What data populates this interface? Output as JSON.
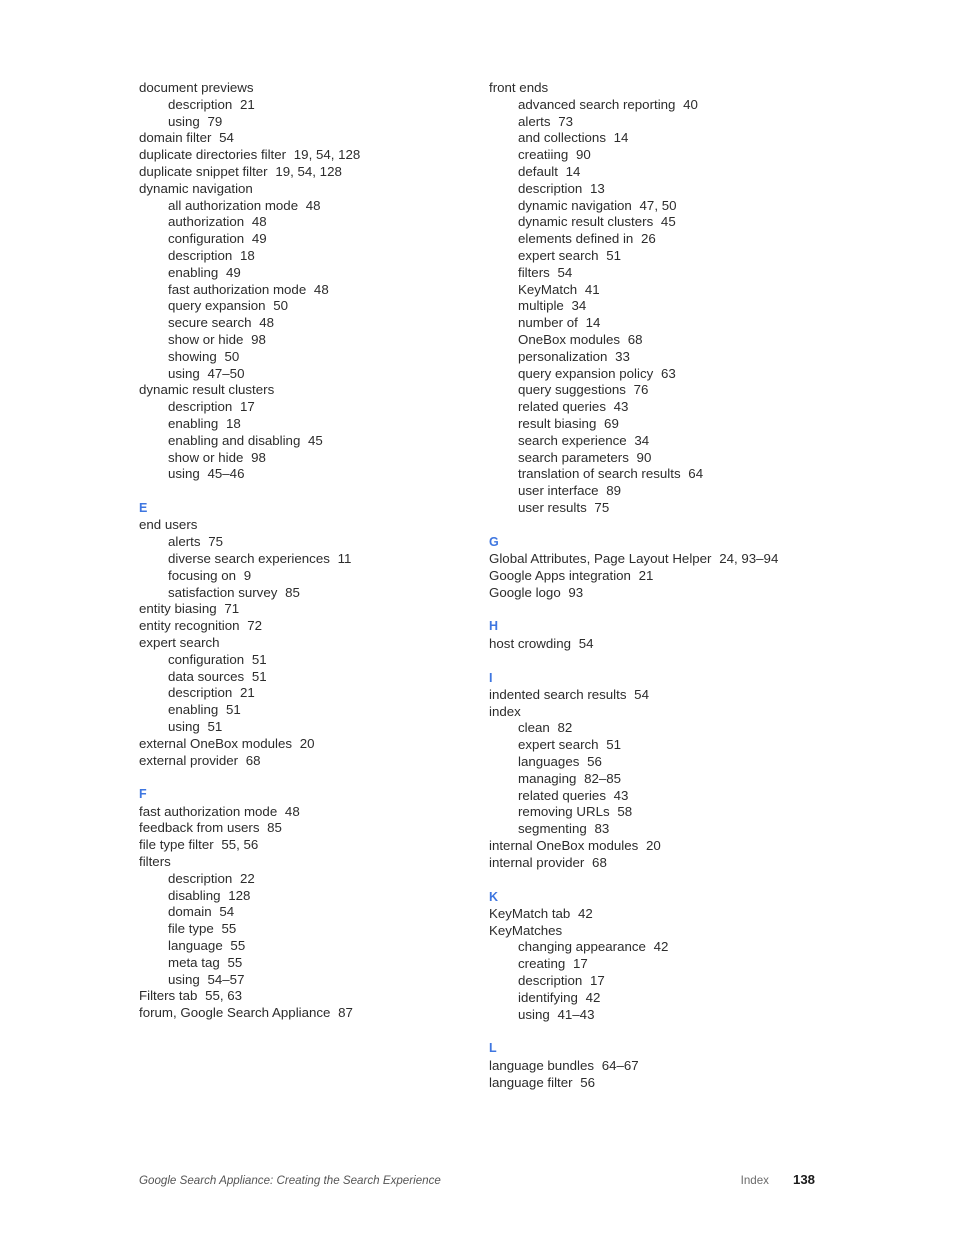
{
  "document": {
    "page_kind": "index",
    "accent_color": "#3e76e0",
    "text_color": "#2c2c2c"
  },
  "columns": [
    {
      "id": "left",
      "sections": [
        {
          "letter": "",
          "entries": [
            {
              "level": 0,
              "text": "document previews",
              "pages": ""
            },
            {
              "level": 1,
              "text": "description",
              "pages": "21"
            },
            {
              "level": 1,
              "text": "using",
              "pages": "79"
            },
            {
              "level": 0,
              "text": "domain filter",
              "pages": "54"
            },
            {
              "level": 0,
              "text": "duplicate directories filter",
              "pages": "19, 54, 128"
            },
            {
              "level": 0,
              "text": "duplicate snippet filter",
              "pages": "19, 54, 128"
            },
            {
              "level": 0,
              "text": "dynamic navigation",
              "pages": ""
            },
            {
              "level": 1,
              "text": "all authorization mode",
              "pages": "48"
            },
            {
              "level": 1,
              "text": "authorization",
              "pages": "48"
            },
            {
              "level": 1,
              "text": "configuration",
              "pages": "49"
            },
            {
              "level": 1,
              "text": "description",
              "pages": "18"
            },
            {
              "level": 1,
              "text": "enabling",
              "pages": "49"
            },
            {
              "level": 1,
              "text": "fast authorization mode",
              "pages": "48"
            },
            {
              "level": 1,
              "text": "query expansion",
              "pages": "50"
            },
            {
              "level": 1,
              "text": "secure search",
              "pages": "48"
            },
            {
              "level": 1,
              "text": "show or hide",
              "pages": "98"
            },
            {
              "level": 1,
              "text": "showing",
              "pages": "50"
            },
            {
              "level": 1,
              "text": "using",
              "pages": "47–50"
            },
            {
              "level": 0,
              "text": "dynamic result clusters",
              "pages": ""
            },
            {
              "level": 1,
              "text": "description",
              "pages": "17"
            },
            {
              "level": 1,
              "text": "enabling",
              "pages": "18"
            },
            {
              "level": 1,
              "text": "enabling and disabling",
              "pages": "45"
            },
            {
              "level": 1,
              "text": "show or hide",
              "pages": "98"
            },
            {
              "level": 1,
              "text": "using",
              "pages": "45–46"
            }
          ]
        },
        {
          "letter": "E",
          "entries": [
            {
              "level": 0,
              "text": "end users",
              "pages": ""
            },
            {
              "level": 1,
              "text": "alerts",
              "pages": "75"
            },
            {
              "level": 1,
              "text": "diverse search experiences",
              "pages": "11"
            },
            {
              "level": 1,
              "text": "focusing on",
              "pages": "9"
            },
            {
              "level": 1,
              "text": "satisfaction survey",
              "pages": "85"
            },
            {
              "level": 0,
              "text": "entity biasing",
              "pages": "71"
            },
            {
              "level": 0,
              "text": "entity recognition",
              "pages": "72"
            },
            {
              "level": 0,
              "text": "expert search",
              "pages": ""
            },
            {
              "level": 1,
              "text": "configuration",
              "pages": "51"
            },
            {
              "level": 1,
              "text": "data sources",
              "pages": "51"
            },
            {
              "level": 1,
              "text": "description",
              "pages": "21"
            },
            {
              "level": 1,
              "text": "enabling",
              "pages": "51"
            },
            {
              "level": 1,
              "text": "using",
              "pages": "51"
            },
            {
              "level": 0,
              "text": "external OneBox modules",
              "pages": "20"
            },
            {
              "level": 0,
              "text": "external provider",
              "pages": "68"
            }
          ]
        },
        {
          "letter": "F",
          "entries": [
            {
              "level": 0,
              "text": "fast authorization mode",
              "pages": "48"
            },
            {
              "level": 0,
              "text": "feedback from users",
              "pages": "85"
            },
            {
              "level": 0,
              "text": "file type filter",
              "pages": "55, 56"
            },
            {
              "level": 0,
              "text": "filters",
              "pages": ""
            },
            {
              "level": 1,
              "text": "description",
              "pages": "22"
            },
            {
              "level": 1,
              "text": "disabling",
              "pages": "128"
            },
            {
              "level": 1,
              "text": "domain",
              "pages": "54"
            },
            {
              "level": 1,
              "text": "file type",
              "pages": "55"
            },
            {
              "level": 1,
              "text": "language",
              "pages": "55"
            },
            {
              "level": 1,
              "text": "meta tag",
              "pages": "55"
            },
            {
              "level": 1,
              "text": "using",
              "pages": "54–57"
            },
            {
              "level": 0,
              "text": "Filters tab",
              "pages": "55, 63"
            },
            {
              "level": 0,
              "text": "forum, Google Search Appliance",
              "pages": "87"
            }
          ]
        }
      ]
    },
    {
      "id": "right",
      "sections": [
        {
          "letter": "",
          "entries": [
            {
              "level": 0,
              "text": "front ends",
              "pages": ""
            },
            {
              "level": 1,
              "text": "advanced search reporting",
              "pages": "40"
            },
            {
              "level": 1,
              "text": "alerts",
              "pages": "73"
            },
            {
              "level": 1,
              "text": "and collections",
              "pages": "14"
            },
            {
              "level": 1,
              "text": "creatiing",
              "pages": "90"
            },
            {
              "level": 1,
              "text": "default",
              "pages": "14"
            },
            {
              "level": 1,
              "text": "description",
              "pages": "13"
            },
            {
              "level": 1,
              "text": "dynamic navigation",
              "pages": "47, 50"
            },
            {
              "level": 1,
              "text": "dynamic result clusters",
              "pages": "45"
            },
            {
              "level": 1,
              "text": "elements defined in",
              "pages": "26"
            },
            {
              "level": 1,
              "text": "expert search",
              "pages": "51"
            },
            {
              "level": 1,
              "text": "filters",
              "pages": "54"
            },
            {
              "level": 1,
              "text": "KeyMatch",
              "pages": "41"
            },
            {
              "level": 1,
              "text": "multiple",
              "pages": "34"
            },
            {
              "level": 1,
              "text": "number of",
              "pages": "14"
            },
            {
              "level": 1,
              "text": "OneBox modules",
              "pages": "68"
            },
            {
              "level": 1,
              "text": "personalization",
              "pages": "33"
            },
            {
              "level": 1,
              "text": "query expansion policy",
              "pages": "63"
            },
            {
              "level": 1,
              "text": "query suggestions",
              "pages": "76"
            },
            {
              "level": 1,
              "text": "related queries",
              "pages": "43"
            },
            {
              "level": 1,
              "text": "result biasing",
              "pages": "69"
            },
            {
              "level": 1,
              "text": "search experience",
              "pages": "34"
            },
            {
              "level": 1,
              "text": "search parameters",
              "pages": "90"
            },
            {
              "level": 1,
              "text": "translation of search results",
              "pages": "64"
            },
            {
              "level": 1,
              "text": "user interface",
              "pages": "89"
            },
            {
              "level": 1,
              "text": "user results",
              "pages": "75"
            }
          ]
        },
        {
          "letter": "G",
          "entries": [
            {
              "level": 0,
              "text": "Global Attributes, Page Layout Helper",
              "pages": "24, 93–94"
            },
            {
              "level": 0,
              "text": "Google Apps integration",
              "pages": "21"
            },
            {
              "level": 0,
              "text": "Google logo",
              "pages": "93"
            }
          ]
        },
        {
          "letter": "H",
          "entries": [
            {
              "level": 0,
              "text": "host crowding",
              "pages": "54"
            }
          ]
        },
        {
          "letter": "I",
          "entries": [
            {
              "level": 0,
              "text": "indented search results",
              "pages": "54"
            },
            {
              "level": 0,
              "text": "index",
              "pages": ""
            },
            {
              "level": 1,
              "text": "clean",
              "pages": "82"
            },
            {
              "level": 1,
              "text": "expert search",
              "pages": "51"
            },
            {
              "level": 1,
              "text": "languages",
              "pages": "56"
            },
            {
              "level": 1,
              "text": "managing",
              "pages": "82–85"
            },
            {
              "level": 1,
              "text": "related queries",
              "pages": "43"
            },
            {
              "level": 1,
              "text": "removing URLs",
              "pages": "58"
            },
            {
              "level": 1,
              "text": "segmenting",
              "pages": "83"
            },
            {
              "level": 0,
              "text": "internal OneBox modules",
              "pages": "20"
            },
            {
              "level": 0,
              "text": "internal provider",
              "pages": "68"
            }
          ]
        },
        {
          "letter": "K",
          "entries": [
            {
              "level": 0,
              "text": "KeyMatch tab",
              "pages": "42"
            },
            {
              "level": 0,
              "text": "KeyMatches",
              "pages": ""
            },
            {
              "level": 1,
              "text": "changing appearance",
              "pages": "42"
            },
            {
              "level": 1,
              "text": "creating",
              "pages": "17"
            },
            {
              "level": 1,
              "text": "description",
              "pages": "17"
            },
            {
              "level": 1,
              "text": "identifying",
              "pages": "42"
            },
            {
              "level": 1,
              "text": "using",
              "pages": "41–43"
            }
          ]
        },
        {
          "letter": "L",
          "entries": [
            {
              "level": 0,
              "text": "language bundles",
              "pages": "64–67"
            },
            {
              "level": 0,
              "text": "language filter",
              "pages": "56"
            }
          ]
        }
      ]
    }
  ],
  "footer": {
    "title": "Google Search Appliance: Creating the Search Experience",
    "section_label": "Index",
    "page_number": "138"
  }
}
